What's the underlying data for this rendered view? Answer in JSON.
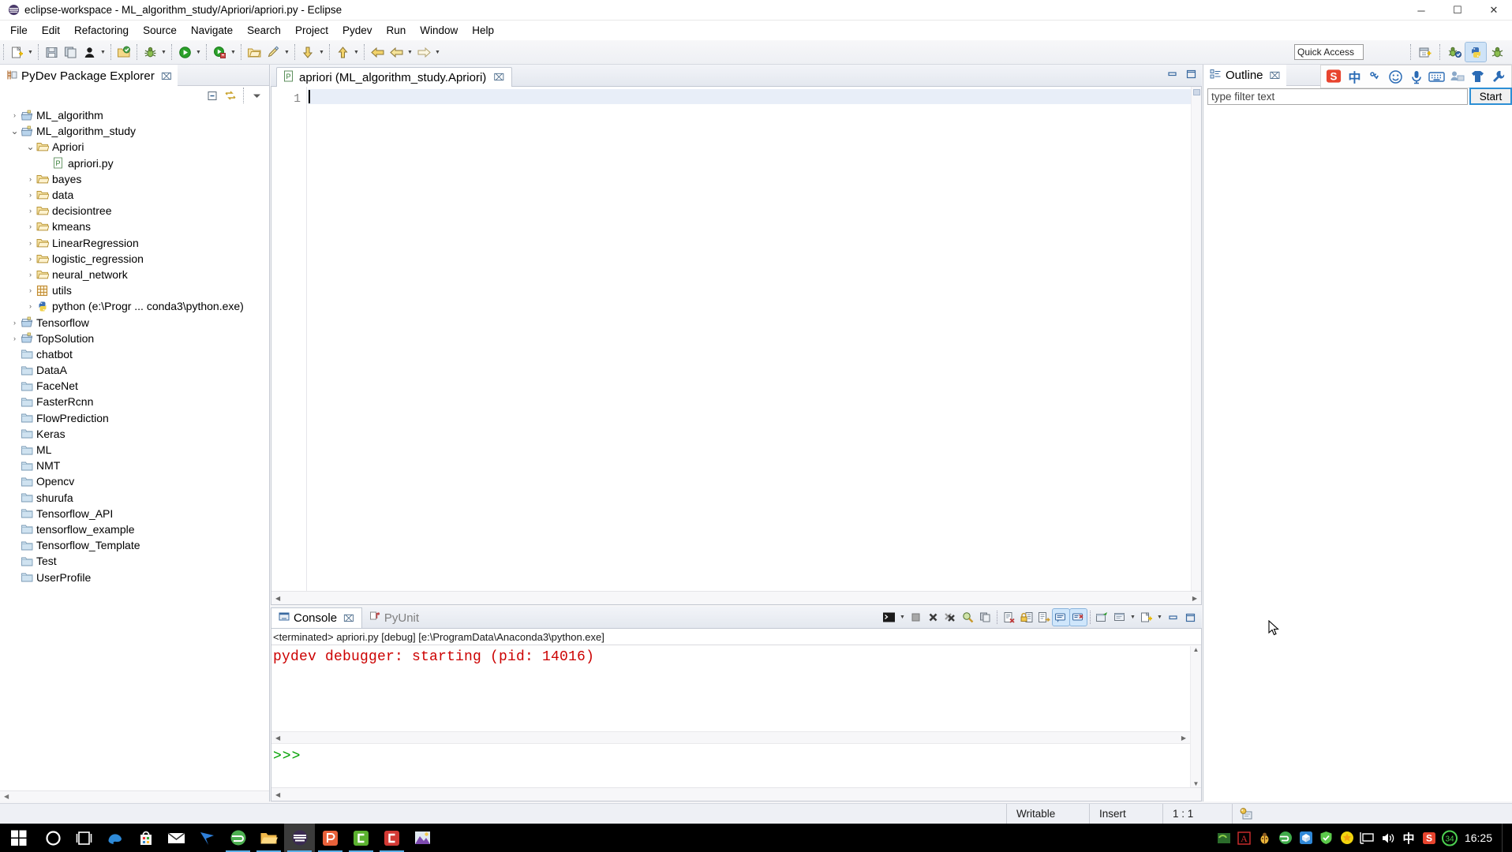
{
  "window": {
    "title": "eclipse-workspace - ML_algorithm_study/Apriori/apriori.py - Eclipse",
    "app_icon": "eclipse-icon",
    "minimize": "─",
    "maximize": "☐",
    "close": "✕"
  },
  "menu": {
    "items": [
      {
        "label": "File",
        "name": "menu-file"
      },
      {
        "label": "Edit",
        "name": "menu-edit"
      },
      {
        "label": "Refactoring",
        "name": "menu-refactoring"
      },
      {
        "label": "Source",
        "name": "menu-source"
      },
      {
        "label": "Navigate",
        "name": "menu-navigate"
      },
      {
        "label": "Search",
        "name": "menu-search"
      },
      {
        "label": "Project",
        "name": "menu-project"
      },
      {
        "label": "Pydev",
        "name": "menu-pydev"
      },
      {
        "label": "Run",
        "name": "menu-run"
      },
      {
        "label": "Window",
        "name": "menu-window"
      },
      {
        "label": "Help",
        "name": "menu-help"
      }
    ]
  },
  "toolbar": {
    "quick_access_placeholder": "Quick Access",
    "quick_access_value": ""
  },
  "explorer": {
    "tab_label": "PyDev Package Explorer",
    "close_glyph": "⌧",
    "tools": [
      "collapse-all-icon",
      "link-with-editor-icon",
      "focus-icon",
      "view-menu-icon"
    ],
    "tree": [
      {
        "label": "ML_algorithm",
        "indent": 0,
        "twist": "›",
        "icon": "project-icon"
      },
      {
        "label": "ML_algorithm_study",
        "indent": 0,
        "twist": "⌄",
        "icon": "project-icon"
      },
      {
        "label": "Apriori",
        "indent": 1,
        "twist": "⌄",
        "icon": "folder-open-icon"
      },
      {
        "label": "apriori.py",
        "indent": 2,
        "twist": "",
        "icon": "python-file-icon"
      },
      {
        "label": "bayes",
        "indent": 1,
        "twist": "›",
        "icon": "folder-icon"
      },
      {
        "label": "data",
        "indent": 1,
        "twist": "›",
        "icon": "folder-icon"
      },
      {
        "label": "decisiontree",
        "indent": 1,
        "twist": "›",
        "icon": "folder-icon"
      },
      {
        "label": "kmeans",
        "indent": 1,
        "twist": "›",
        "icon": "folder-icon"
      },
      {
        "label": "LinearRegression",
        "indent": 1,
        "twist": "›",
        "icon": "folder-icon"
      },
      {
        "label": "logistic_regression",
        "indent": 1,
        "twist": "›",
        "icon": "folder-icon"
      },
      {
        "label": "neural_network",
        "indent": 1,
        "twist": "›",
        "icon": "folder-icon"
      },
      {
        "label": "utils",
        "indent": 1,
        "twist": "›",
        "icon": "package-grid-icon"
      },
      {
        "label": "python  (e:\\Progr ... conda3\\python.exe)",
        "indent": 1,
        "twist": "›",
        "icon": "python-interpreter-icon"
      },
      {
        "label": "Tensorflow",
        "indent": 0,
        "twist": "›",
        "icon": "project-icon"
      },
      {
        "label": "TopSolution",
        "indent": 0,
        "twist": "›",
        "icon": "project-icon"
      },
      {
        "label": "chatbot",
        "indent": 0,
        "twist": "",
        "icon": "closed-project-icon"
      },
      {
        "label": "DataA",
        "indent": 0,
        "twist": "",
        "icon": "closed-project-icon"
      },
      {
        "label": "FaceNet",
        "indent": 0,
        "twist": "",
        "icon": "closed-project-icon"
      },
      {
        "label": "FasterRcnn",
        "indent": 0,
        "twist": "",
        "icon": "closed-project-icon"
      },
      {
        "label": "FlowPrediction",
        "indent": 0,
        "twist": "",
        "icon": "closed-project-icon"
      },
      {
        "label": "Keras",
        "indent": 0,
        "twist": "",
        "icon": "closed-project-icon"
      },
      {
        "label": "ML",
        "indent": 0,
        "twist": "",
        "icon": "closed-project-icon"
      },
      {
        "label": "NMT",
        "indent": 0,
        "twist": "",
        "icon": "closed-project-icon"
      },
      {
        "label": "Opencv",
        "indent": 0,
        "twist": "",
        "icon": "closed-project-icon"
      },
      {
        "label": "shurufa",
        "indent": 0,
        "twist": "",
        "icon": "closed-project-icon"
      },
      {
        "label": "Tensorflow_API",
        "indent": 0,
        "twist": "",
        "icon": "closed-project-icon"
      },
      {
        "label": "tensorflow_example",
        "indent": 0,
        "twist": "",
        "icon": "closed-project-icon"
      },
      {
        "label": "Tensorflow_Template",
        "indent": 0,
        "twist": "",
        "icon": "closed-project-icon"
      },
      {
        "label": "Test",
        "indent": 0,
        "twist": "",
        "icon": "closed-project-icon"
      },
      {
        "label": "UserProfile",
        "indent": 0,
        "twist": "",
        "icon": "closed-project-icon"
      }
    ]
  },
  "editor": {
    "tab_label": "apriori (ML_algorithm_study.Apriori)",
    "tab_icon": "python-file-icon",
    "close_glyph": "⌧",
    "line_number": "1",
    "content": "",
    "minimize_glyph": "─",
    "maximize_glyph": "☐"
  },
  "console": {
    "tabs": [
      {
        "label": "Console",
        "active": true,
        "icon": "console-icon",
        "close_glyph": "⌧"
      },
      {
        "label": "PyUnit",
        "active": false,
        "icon": "pyunit-icon"
      }
    ],
    "header": "<terminated> apriori.py [debug] [e:\\ProgramData\\Anaconda3\\python.exe]",
    "output_line": "pydev debugger: starting (pid: 14016)",
    "prompt": ">>>",
    "output_color": "#cc0000",
    "prompt_color": "#00a000",
    "tools": [
      "terminate-icon",
      "display-selected-console-dropdown",
      "stop-icon",
      "remove-launch-icon",
      "remove-all-terminated-icon",
      "open-console-icon",
      "copy-icon",
      "clear-console-icon",
      "lock-scroll-icon",
      "show-console-on-output-icon",
      "pin-console-icon",
      "scroll-lock-icon",
      "new-console-view-icon",
      "display-selected-console-icon",
      "open-console-dropdown",
      "minimize-icon",
      "maximize-icon"
    ]
  },
  "outline": {
    "tab_label": "Outline",
    "close_glyph": "⌧",
    "filter_placeholder": "type filter text",
    "filter_value": "",
    "start_button": "Start"
  },
  "ime": {
    "icons": [
      "sogou-logo-icon",
      "chinese-mode-icon",
      "punctuation-icon",
      "emoji-icon",
      "voice-input-icon",
      "soft-keyboard-icon",
      "user-icon",
      "skin-icon",
      "toolbox-icon"
    ],
    "chinese_glyph": "中"
  },
  "statusbar": {
    "writable": "Writable",
    "insert": "Insert",
    "position": "1 : 1",
    "icon": "smart-insert-icon"
  },
  "taskbar": {
    "items": [
      {
        "name": "start-button",
        "icon": "windows-logo-icon"
      },
      {
        "name": "cortana-search",
        "icon": "cortana-circle-icon"
      },
      {
        "name": "task-view",
        "icon": "task-view-icon"
      },
      {
        "name": "taskbar-edge",
        "icon": "edge-icon"
      },
      {
        "name": "taskbar-store",
        "icon": "store-icon"
      },
      {
        "name": "taskbar-mail",
        "icon": "mail-icon"
      },
      {
        "name": "taskbar-app-blue",
        "icon": "blue-bird-icon"
      },
      {
        "name": "taskbar-app-green",
        "icon": "green-globe-icon"
      },
      {
        "name": "taskbar-explorer",
        "icon": "file-explorer-icon"
      },
      {
        "name": "taskbar-eclipse",
        "icon": "eclipse-icon"
      },
      {
        "name": "taskbar-pdf",
        "icon": "orange-p-icon"
      },
      {
        "name": "taskbar-green-c",
        "icon": "green-c-icon"
      },
      {
        "name": "taskbar-red-c",
        "icon": "red-c-icon"
      },
      {
        "name": "taskbar-photos",
        "icon": "photos-icon"
      }
    ],
    "tray": [
      {
        "name": "tray-nvidia",
        "icon": "nvidia-icon"
      },
      {
        "name": "tray-acrobat",
        "icon": "adobe-reader-icon"
      },
      {
        "name": "tray-utility",
        "icon": "ladybug-icon"
      },
      {
        "name": "tray-browser",
        "icon": "green-globe-icon"
      },
      {
        "name": "tray-box",
        "icon": "blue-cube-icon"
      },
      {
        "name": "tray-security",
        "icon": "shield-icon"
      },
      {
        "name": "tray-360",
        "icon": "yellow-ball-icon"
      },
      {
        "name": "tray-network",
        "icon": "monitor-icon"
      },
      {
        "name": "tray-volume",
        "icon": "speaker-icon"
      },
      {
        "name": "tray-ime",
        "icon": "chinese-ime-icon",
        "glyph": "中"
      },
      {
        "name": "tray-sogou",
        "icon": "sogou-logo-icon"
      },
      {
        "name": "tray-badge",
        "icon": "green-badge-icon",
        "glyph": "34"
      }
    ],
    "clock": "16:25"
  }
}
